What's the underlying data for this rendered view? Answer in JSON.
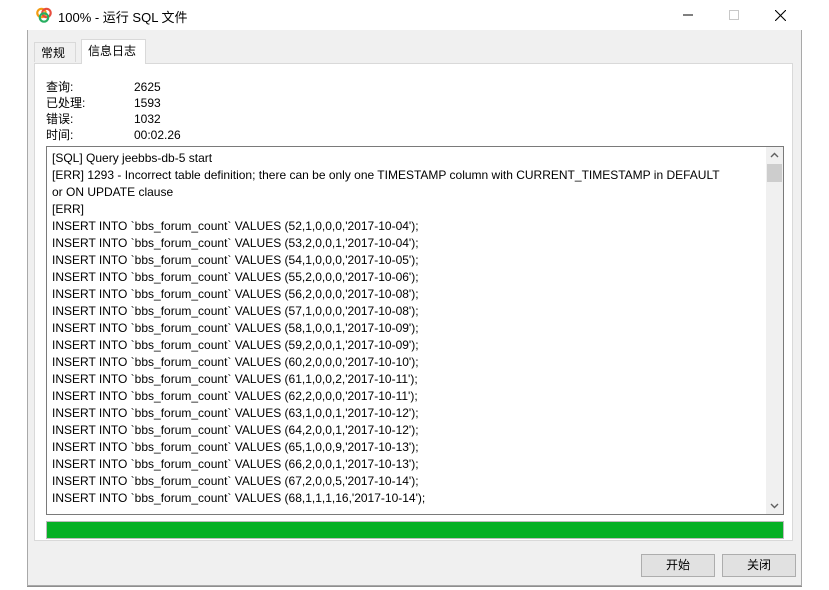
{
  "window": {
    "title": "100% - 运行 SQL 文件"
  },
  "tabs": [
    {
      "label": "常规"
    },
    {
      "label": "信息日志"
    }
  ],
  "stats": {
    "query_label": "查询:",
    "query_value": "2625",
    "processed_label": "已处理:",
    "processed_value": "1593",
    "errors_label": "错误:",
    "errors_value": "1032",
    "time_label": "时间:",
    "time_value": "00:02.26"
  },
  "log": [
    "[SQL] Query jeebbs-db-5 start",
    "[ERR] 1293 - Incorrect table definition; there can be only one TIMESTAMP column with CURRENT_TIMESTAMP in DEFAULT",
    "or ON UPDATE clause",
    "[ERR]",
    "INSERT INTO `bbs_forum_count` VALUES (52,1,0,0,0,'2017-10-04');",
    "INSERT INTO `bbs_forum_count` VALUES (53,2,0,0,1,'2017-10-04');",
    "INSERT INTO `bbs_forum_count` VALUES (54,1,0,0,0,'2017-10-05');",
    "INSERT INTO `bbs_forum_count` VALUES (55,2,0,0,0,'2017-10-06');",
    "INSERT INTO `bbs_forum_count` VALUES (56,2,0,0,0,'2017-10-08');",
    "INSERT INTO `bbs_forum_count` VALUES (57,1,0,0,0,'2017-10-08');",
    "INSERT INTO `bbs_forum_count` VALUES (58,1,0,0,1,'2017-10-09');",
    "INSERT INTO `bbs_forum_count` VALUES (59,2,0,0,1,'2017-10-09');",
    "INSERT INTO `bbs_forum_count` VALUES (60,2,0,0,0,'2017-10-10');",
    "INSERT INTO `bbs_forum_count` VALUES (61,1,0,0,2,'2017-10-11');",
    "INSERT INTO `bbs_forum_count` VALUES (62,2,0,0,0,'2017-10-11');",
    "INSERT INTO `bbs_forum_count` VALUES (63,1,0,0,1,'2017-10-12');",
    "INSERT INTO `bbs_forum_count` VALUES (64,2,0,0,1,'2017-10-12');",
    "INSERT INTO `bbs_forum_count` VALUES (65,1,0,0,9,'2017-10-13');",
    "INSERT INTO `bbs_forum_count` VALUES (66,2,0,0,1,'2017-10-13');",
    "INSERT INTO `bbs_forum_count` VALUES (67,2,0,0,5,'2017-10-14');",
    "INSERT INTO `bbs_forum_count` VALUES (68,1,1,1,16,'2017-10-14');"
  ],
  "progress": {
    "percent": 100,
    "color": "#06b025"
  },
  "buttons": {
    "start_label": "开始",
    "close_label": "关闭"
  },
  "icons": {
    "app": "navicat-icon",
    "minimize": "minimize-icon",
    "maximize": "maximize-icon",
    "close": "close-icon"
  }
}
